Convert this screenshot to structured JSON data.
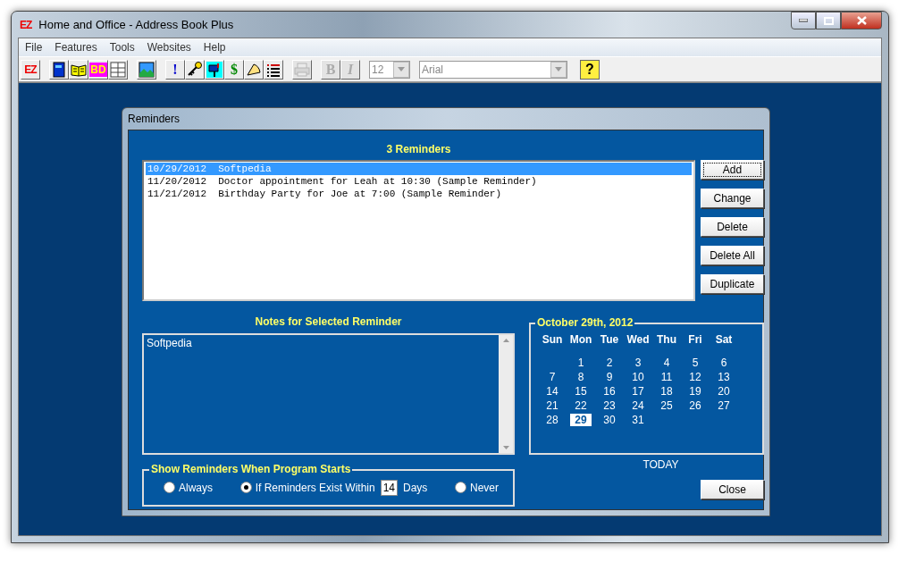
{
  "window": {
    "logo": "EZ",
    "title": "Home and Office - Address Book Plus"
  },
  "menu": [
    {
      "label": "File"
    },
    {
      "label": "Features"
    },
    {
      "label": "Tools"
    },
    {
      "label": "Websites"
    },
    {
      "label": "Help"
    }
  ],
  "toolbar": [
    [
      {
        "kind": "logo",
        "label": "EZ",
        "disabled": false
      }
    ],
    [
      {
        "kind": "book",
        "disabled": false
      },
      {
        "kind": "open-book",
        "disabled": false
      },
      {
        "kind": "text",
        "label": "BD",
        "disabled": false
      },
      {
        "kind": "grid",
        "disabled": false
      }
    ],
    [
      {
        "kind": "landscape",
        "disabled": false
      }
    ],
    [
      {
        "kind": "text",
        "label": "!",
        "disabled": false
      },
      {
        "kind": "key",
        "disabled": false
      },
      {
        "kind": "mailbox",
        "disabled": false
      },
      {
        "kind": "text",
        "label": "$",
        "disabled": false
      },
      {
        "kind": "pie",
        "disabled": false
      },
      {
        "kind": "list",
        "disabled": false
      }
    ],
    [
      {
        "kind": "printer",
        "disabled": true
      }
    ],
    [
      {
        "kind": "text",
        "label": "B",
        "disabled": true
      },
      {
        "kind": "text",
        "label": "I",
        "disabled": true
      }
    ]
  ],
  "font_size": {
    "value": "12",
    "disabled": true
  },
  "font_name": {
    "value": "Arial",
    "disabled": true
  },
  "help_button": {
    "label": "?"
  },
  "dialog": {
    "title": "Reminders",
    "list_heading": "3 Reminders",
    "reminders": [
      {
        "date": "10/29/2012",
        "text": "Softpedia",
        "selected": true
      },
      {
        "date": "11/20/2012",
        "text": "Doctor appointment for Leah at 10:30 (Sample Reminder)",
        "selected": false
      },
      {
        "date": "11/21/2012",
        "text": "Birthday Party for Joe at 7:00 (Sample Reminder)",
        "selected": false
      }
    ],
    "buttons": [
      {
        "label": "Add",
        "focused": true
      },
      {
        "label": "Change",
        "focused": false
      },
      {
        "label": "Delete",
        "focused": false
      },
      {
        "label": "Delete All",
        "focused": false
      },
      {
        "label": "Duplicate",
        "focused": false
      }
    ],
    "notes_heading": "Notes for Selected Reminder",
    "notes": "Softpedia",
    "startup_group": {
      "title": "Show Reminders When Program Starts",
      "options": [
        {
          "label": "Always",
          "selected": false
        },
        {
          "label": "If Reminders Exist Within",
          "selected": true,
          "days": "14",
          "suffix": "Days"
        },
        {
          "label": "Never",
          "selected": false
        }
      ]
    },
    "calendar": {
      "title": "October 29th, 2012",
      "weekdays": [
        "Sun",
        "Mon",
        "Tue",
        "Wed",
        "Thu",
        "Fri",
        "Sat"
      ],
      "weeks": [
        [
          {
            "day": "1",
            "selected": false
          },
          {
            "day": "2",
            "selected": false
          },
          {
            "day": "3",
            "selected": false
          },
          {
            "day": "4",
            "selected": false
          },
          {
            "day": "5",
            "selected": false
          },
          {
            "day": "6",
            "selected": false
          }
        ],
        [
          {
            "day": "7",
            "selected": false
          },
          {
            "day": "8",
            "selected": false
          },
          {
            "day": "9",
            "selected": false
          },
          {
            "day": "10",
            "selected": false
          },
          {
            "day": "11",
            "selected": false
          },
          {
            "day": "12",
            "selected": false
          },
          {
            "day": "13",
            "selected": false
          }
        ],
        [
          {
            "day": "14",
            "selected": false
          },
          {
            "day": "15",
            "selected": false
          },
          {
            "day": "16",
            "selected": false
          },
          {
            "day": "17",
            "selected": false
          },
          {
            "day": "18",
            "selected": false
          },
          {
            "day": "19",
            "selected": false
          },
          {
            "day": "20",
            "selected": false
          }
        ],
        [
          {
            "day": "21",
            "selected": false
          },
          {
            "day": "22",
            "selected": false
          },
          {
            "day": "23",
            "selected": false
          },
          {
            "day": "24",
            "selected": false
          },
          {
            "day": "25",
            "selected": false
          },
          {
            "day": "26",
            "selected": false
          },
          {
            "day": "27",
            "selected": false
          }
        ],
        [
          {
            "day": "28",
            "selected": false
          },
          {
            "day": "29",
            "selected": true
          },
          {
            "day": "30",
            "selected": false
          },
          {
            "day": "31",
            "selected": false
          }
        ]
      ],
      "today_button": "TODAY"
    },
    "close_button": "Close"
  }
}
